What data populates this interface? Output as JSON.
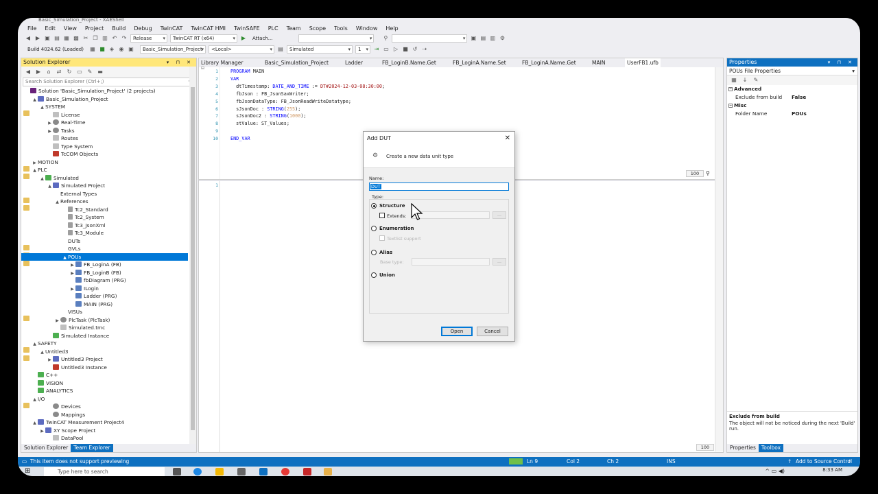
{
  "window": {
    "title": "Basic_Simulation_Project - XAEShell"
  },
  "menu": [
    "File",
    "Edit",
    "View",
    "Project",
    "Build",
    "Debug",
    "TwinCAT",
    "TwinCAT HMI",
    "TwinSAFE",
    "PLC",
    "Team",
    "Scope",
    "Tools",
    "Window",
    "Help"
  ],
  "toolbar": {
    "config": "Release",
    "platform": "TwinCAT RT (x64)",
    "attach": "Attach...",
    "build": "Build 4024.62 (Loaded)",
    "project": "Basic_Simulation_Project",
    "target": "<Local>",
    "mode": "Simulated",
    "index": "1"
  },
  "solution_explorer": {
    "title": "Solution Explorer",
    "search_placeholder": "Search Solution Explorer (Ctrl+;)",
    "tree": [
      "Solution 'Basic_Simulation_Project' (2 projects)",
      "Basic_Simulation_Project",
      "SYSTEM",
      "License",
      "Real-Time",
      "Tasks",
      "Routes",
      "Type System",
      "TcCOM Objects",
      "MOTION",
      "PLC",
      "Simulated",
      "Simulated Project",
      "External Types",
      "References",
      "Tc2_Standard",
      "Tc2_System",
      "Tc3_JsonXml",
      "Tc3_Module",
      "DUTs",
      "GVLs",
      "POUs",
      "FB_LoginA (FB)",
      "FB_LoginB (FB)",
      "fbDiagram (PRG)",
      "ILogin",
      "Ladder (PRG)",
      "MAIN (PRG)",
      "VISUs",
      "PlcTask (PlcTask)",
      "Simulated.tmc",
      "Simulated Instance",
      "SAFETY",
      "Untitled3",
      "Untitled3 Project",
      "Untitled3 Instance",
      "C++",
      "VISION",
      "ANALYTICS",
      "I/O",
      "Devices",
      "Mappings",
      "TwinCAT Measurement Project4",
      "XY Scope Project",
      "DataPool"
    ],
    "tabs": [
      "Solution Explorer",
      "Team Explorer"
    ]
  },
  "editor": {
    "tabs": [
      "Library Manager",
      "Basic_Simulation_Project",
      "Ladder",
      "FB_LoginB.Name.Get",
      "FB_LoginA.Name.Set",
      "FB_LoginA.Name.Get",
      "MAIN",
      "UserFB1.ufb"
    ],
    "lines": [
      {
        "n": "1",
        "t": "PROGRAM MAIN"
      },
      {
        "n": "2",
        "t": "VAR"
      },
      {
        "n": "3",
        "t": "  dtTimestamp: DATE_AND_TIME := DT#2024-12-03-08:30:00;"
      },
      {
        "n": "4",
        "t": "  fbJson : FB_JsonSaxWriter;"
      },
      {
        "n": "5",
        "t": "  fbJsonDataType: FB_JsonReadWriteDatatype;"
      },
      {
        "n": "6",
        "t": "  sJsonDoc : STRING(255);"
      },
      {
        "n": "7",
        "t": "  sJsonDoc2 : STRING(1000);"
      },
      {
        "n": "8",
        "t": "  stValue: ST_Values;"
      },
      {
        "n": "9",
        "t": ""
      },
      {
        "n": "10",
        "t": "END_VAR"
      }
    ],
    "impl_line": "1",
    "zoom_top": "100",
    "zoom_bottom": "100"
  },
  "properties": {
    "title": "Properties",
    "selector": "POUs  File Properties",
    "categories": [
      {
        "name": "Advanced",
        "items": [
          {
            "k": "Exclude from build",
            "v": "False"
          }
        ]
      },
      {
        "name": "Misc",
        "items": [
          {
            "k": "Folder Name",
            "v": "POUs"
          }
        ]
      }
    ],
    "desc_title": "Exclude from build",
    "desc_text": "The object will not be noticed during the next 'Build' run.",
    "tabs": [
      "Properties",
      "Toolbox"
    ]
  },
  "dialog": {
    "title": "Add DUT",
    "header": "Create a new data unit type",
    "name_label": "Name:",
    "name_value": "DUT",
    "type_label": "Type:",
    "structure": "Structure",
    "extends": "Extends:",
    "enumeration": "Enumeration",
    "textlist": "Textlist support",
    "alias": "Alias",
    "base_type": "Base type:",
    "union": "Union",
    "open": "Open",
    "cancel": "Cancel"
  },
  "status": {
    "message": "This item does not support previewing",
    "ln": "Ln 9",
    "col": "Col 2",
    "ch": "Ch 2",
    "ins": "INS",
    "source_control": "Add to Source Control"
  },
  "taskbar": {
    "search": "Type here to search",
    "time": "8:33 AM"
  }
}
